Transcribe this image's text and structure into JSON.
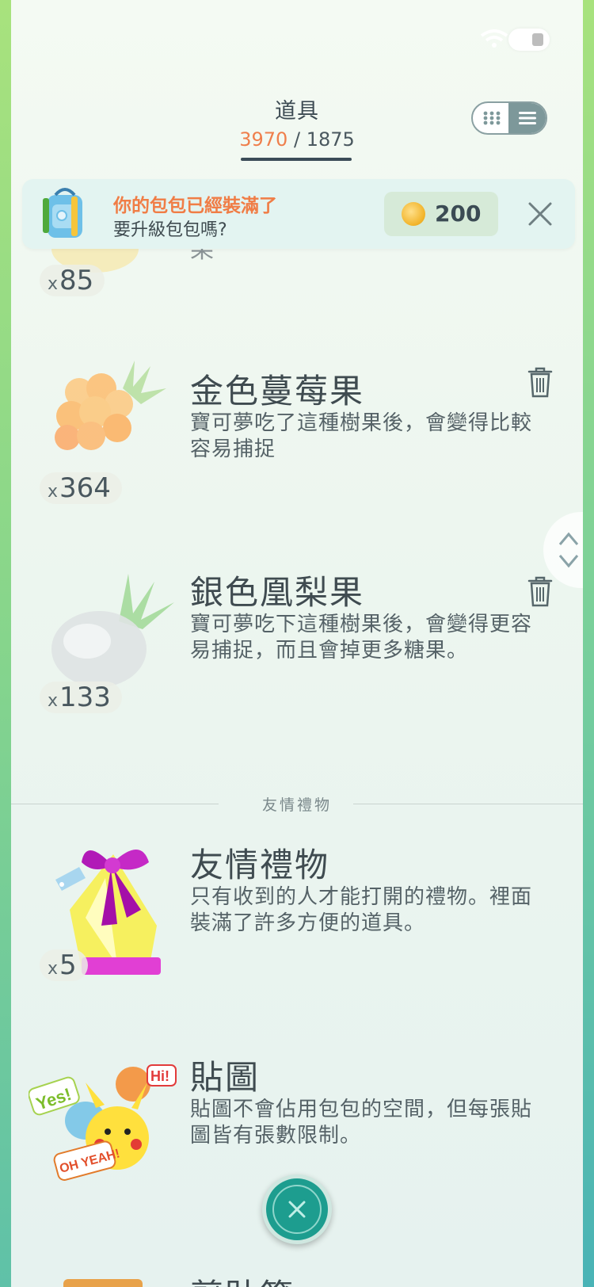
{
  "header": {
    "title": "道具",
    "count_current": "3970",
    "count_separator": "/",
    "count_max": "1875"
  },
  "banner": {
    "line1": "你的包包已經裝滿了",
    "line2": "要升級包包嗎?",
    "coin_value": "200"
  },
  "items": [
    {
      "qty_prefix": "x",
      "qty": "85",
      "name_fragment": "果"
    },
    {
      "name": "金色蔓莓果",
      "desc": "寶可夢吃了這種樹果後，會變得比較容易捕捉",
      "qty_prefix": "x",
      "qty": "364"
    },
    {
      "name": "銀色凰梨果",
      "desc": "寶可夢吃下這種樹果後，會變得更容易捕捉，而且會掉更多糖果。",
      "qty_prefix": "x",
      "qty": "133"
    }
  ],
  "section": {
    "label": "友情禮物"
  },
  "gift_items": [
    {
      "name": "友情禮物",
      "desc": "只有收到的人才能打開的禮物。裡面裝滿了許多方便的道具。",
      "qty_prefix": "x",
      "qty": "5"
    },
    {
      "name": "貼圖",
      "desc": "貼圖不會佔用包包的空間，但每張貼圖皆有張數限制。"
    },
    {
      "name": "剪貼簿"
    }
  ],
  "sticker_texts": {
    "yes": "Yes!",
    "hi": "Hi!",
    "oh_yeah": "OH YEAH!"
  },
  "colors": {
    "accent_orange": "#f07d46",
    "teal": "#1d9d8f",
    "text_dark": "#3f4b50"
  },
  "icons": [
    "grid-icon",
    "list-icon",
    "backpack-icon",
    "coin-icon",
    "close-icon",
    "trash-icon",
    "chevron-up-icon",
    "chevron-down-icon"
  ]
}
